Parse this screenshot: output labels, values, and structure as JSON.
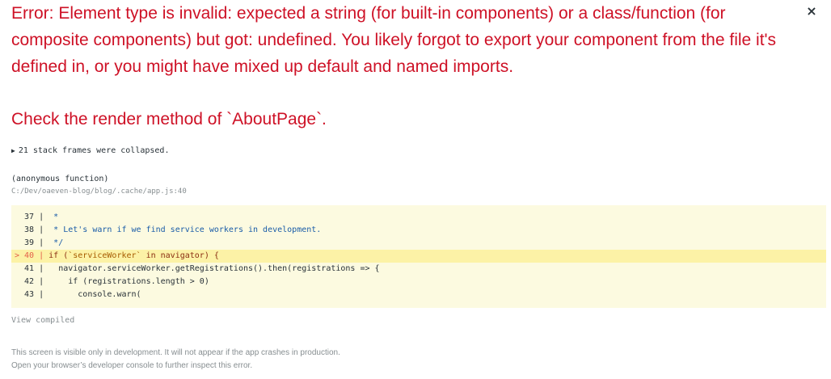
{
  "error": {
    "message": "Error: Element type is invalid: expected a string (for built-in components) or a class/function (for composite components) but got: undefined. You likely forgot to export your component from the file it's defined in, or you might have mixed up default and named imports.",
    "detail": "Check the render method of `AboutPage`.",
    "close_glyph": "×"
  },
  "stack": {
    "collapsed_label": "21 stack frames were collapsed.",
    "toggle_glyph": "▶",
    "frame": {
      "function_name": "(anonymous function)",
      "file_path": "C:/Dev/oaeven-blog/blog/.cache/app.js:40"
    },
    "code_lines": [
      {
        "gutter": "  37 | ",
        "code": " *"
      },
      {
        "gutter": "  38 | ",
        "code": " * Let's warn if we find service workers in development."
      },
      {
        "gutter": "  39 | ",
        "code": " */"
      },
      {
        "gutter": "> 40 | ",
        "code_parts": [
          "if (",
          "`serviceWorker`",
          " in navigator) {"
        ]
      },
      {
        "gutter": "  41 | ",
        "code": "  navigator.serviceWorker.getRegistrations().then(registrations => {"
      },
      {
        "gutter": "  42 | ",
        "code": "    if (registrations.length > 0)"
      },
      {
        "gutter": "  43 | ",
        "code": "      console.warn("
      }
    ],
    "view_compiled": "View compiled"
  },
  "footer": {
    "line1": "This screen is visible only in development. It will not appear if the app crashes in production.",
    "line2": "Open your browser’s developer console to further inspect this error."
  },
  "colors": {
    "error_red": "#ce1126",
    "code_bg": "#fcfae0",
    "highlight_bg": "#fcf2a6",
    "muted": "#878e91"
  }
}
